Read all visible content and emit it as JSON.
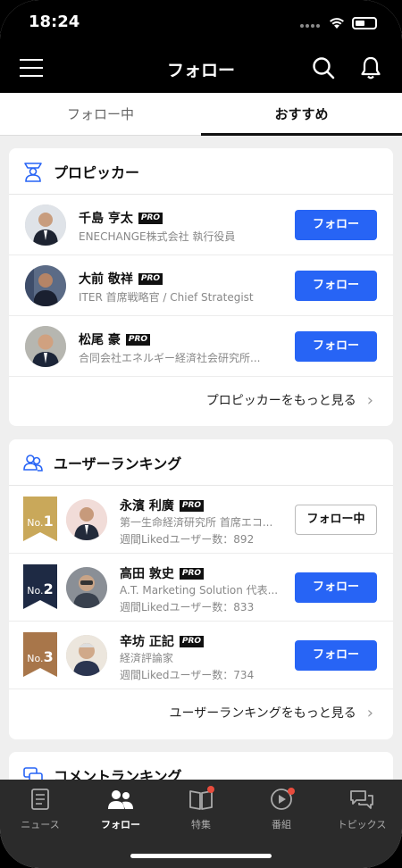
{
  "status": {
    "time": "18:24"
  },
  "header": {
    "title": "フォロー"
  },
  "tabs": [
    {
      "label": "フォロー中",
      "active": false
    },
    {
      "label": "おすすめ",
      "active": true
    }
  ],
  "pro_pickers": {
    "title": "プロピッカー",
    "items": [
      {
        "name": "千島 亨太",
        "badge": "PRO",
        "subtitle": "ENECHANGE株式会社 執行役員",
        "button": "フォロー"
      },
      {
        "name": "大前 敬祥",
        "badge": "PRO",
        "subtitle": "ITER 首席戦略官 / Chief Strategist",
        "button": "フォロー"
      },
      {
        "name": "松尾 豪",
        "badge": "PRO",
        "subtitle": "合同会社エネルギー経済社会研究所...",
        "button": "フォロー"
      }
    ],
    "more": "プロピッカーをもっと見る"
  },
  "user_ranking": {
    "title": "ユーザーランキング",
    "items": [
      {
        "rank_prefix": "No.",
        "rank": "1",
        "name": "永濱 利廣",
        "badge": "PRO",
        "subtitle": "第一生命経済研究所 首席エコ...",
        "stat": "週間Likedユーザー数：892",
        "button": "フォロー中",
        "rank_color": "#c9a85a"
      },
      {
        "rank_prefix": "No.",
        "rank": "2",
        "name": "高田 敦史",
        "badge": "PRO",
        "subtitle": "A.T. Marketing Solution 代表...",
        "stat": "週間Likedユーザー数：833",
        "button": "フォロー",
        "rank_color": "#1e2a44"
      },
      {
        "rank_prefix": "No.",
        "rank": "3",
        "name": "辛坊 正記",
        "badge": "PRO",
        "subtitle": "経済評論家",
        "stat": "週間Likedユーザー数：734",
        "button": "フォロー",
        "rank_color": "#a8764a"
      }
    ],
    "more": "ユーザーランキングをもっと見る"
  },
  "comment_ranking": {
    "title": "コメントランキング"
  },
  "tabbar": [
    {
      "label": "ニュース",
      "icon": "news-icon",
      "active": false
    },
    {
      "label": "フォロー",
      "icon": "people-icon",
      "active": true
    },
    {
      "label": "特集",
      "icon": "book-icon",
      "active": false
    },
    {
      "label": "番組",
      "icon": "play-icon",
      "active": false
    },
    {
      "label": "トピックス",
      "icon": "chat-icon",
      "active": false
    }
  ],
  "colors": {
    "accent": "#2764f5",
    "header_bg": "#000000",
    "tabbar_bg": "#2b2b2b",
    "notification_dot": "#e84c3d"
  }
}
